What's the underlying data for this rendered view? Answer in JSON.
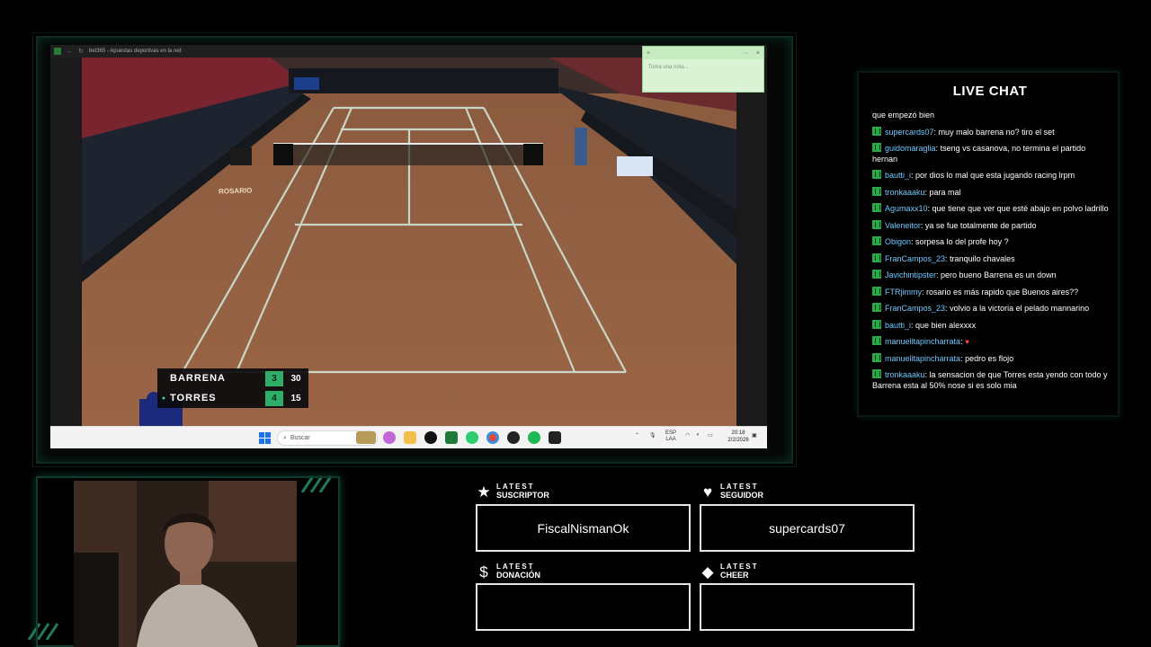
{
  "browser": {
    "title": "bet365 - Apuestas deportivas en la red"
  },
  "video": {
    "venue_logo": "ROSARIO",
    "scoreboard": {
      "players": [
        {
          "name": "BARRENA",
          "games": "3",
          "points": "30",
          "serving": false
        },
        {
          "name": "TORRES",
          "games": "4",
          "points": "15",
          "serving": true
        }
      ]
    }
  },
  "note": {
    "placeholder": "Toma una nota...",
    "menu_label": "···",
    "close_label": "×",
    "add_label": "+"
  },
  "taskbar": {
    "search_placeholder": "Buscar",
    "language_line1": "ESP",
    "language_line2": "LAA",
    "time": "20:18",
    "date": "2/2/2026"
  },
  "chat": {
    "title": "LIVE CHAT",
    "messages": [
      {
        "user": "",
        "text": "que empezó bien"
      },
      {
        "user": "supercards07",
        "text": "muy malo barrena no? tiro el set"
      },
      {
        "user": "guidomaraglia",
        "text": "tseng vs casanova, no termina el partido hernan"
      },
      {
        "user": "bautti_i",
        "text": "por dios lo mal que esta jugando racing lrpm"
      },
      {
        "user": "tronkaaaku",
        "text": "para mal"
      },
      {
        "user": "Agumaxx10",
        "text": "que tiene que ver que esté abajo en polvo ladrillo"
      },
      {
        "user": "Valeneitor",
        "text": "ya se fue totalmente de partido"
      },
      {
        "user": "Obigon",
        "text": "sorpesa lo del profe hoy ?"
      },
      {
        "user": "FranCampos_23",
        "text": "tranquilo chavales"
      },
      {
        "user": "Javichintipster",
        "text": "pero bueno Barrena es un down"
      },
      {
        "user": "FTRjimmy",
        "text": "rosario es más rapido que Buenos aires??"
      },
      {
        "user": "FranCampos_23",
        "text": "volvio a la victoria el pelado mannarino"
      },
      {
        "user": "bautti_i",
        "text": "que bien alexxxx"
      },
      {
        "user": "manuelitapincharrata",
        "text": "♥"
      },
      {
        "user": "manuelitapincharrata",
        "text": "pedro es flojo"
      },
      {
        "user": "tronkaaaku",
        "text": "la sensacion de que Torres esta yendo con todo y Barrena esta al 50% nose si es solo mia"
      }
    ]
  },
  "alerts": {
    "subscriber": {
      "label_top": "LATEST",
      "label_bottom": "SUSCRIPTOR",
      "value": "FiscalNismanOk",
      "icon": "star-icon"
    },
    "follower": {
      "label_top": "LATEST",
      "label_bottom": "SEGUIDOR",
      "value": "supercards07",
      "icon": "heart-icon"
    },
    "donation": {
      "label_top": "LATEST",
      "label_bottom": "DONACIÓN",
      "value": "",
      "icon": "dollar-icon"
    },
    "cheer": {
      "label_top": "LATEST",
      "label_bottom": "CHEER",
      "value": "",
      "icon": "diamond-icon"
    }
  },
  "colors": {
    "accent_green": "#1f7a5a",
    "chat_username": "#6ec9ff",
    "scoreboard_games": "#2fae6a",
    "clay": "#8f5d3f"
  }
}
